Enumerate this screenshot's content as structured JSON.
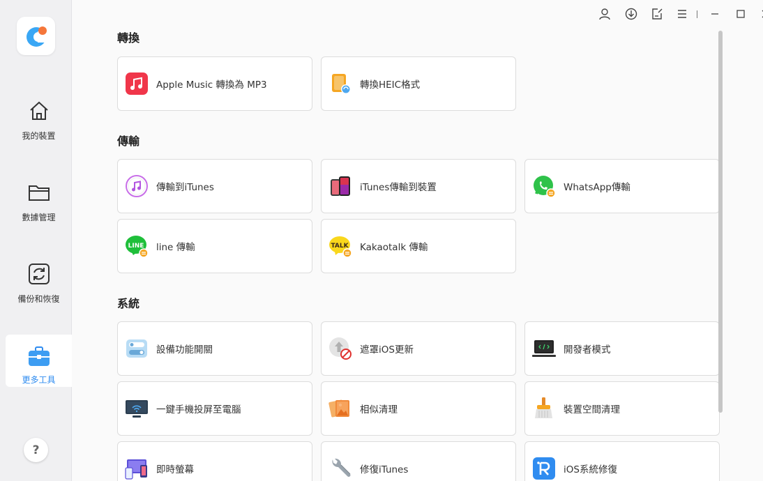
{
  "sidebar": {
    "items": [
      {
        "label": "我的裝置",
        "icon": "home-icon"
      },
      {
        "label": "數據管理",
        "icon": "folder-icon"
      },
      {
        "label": "備份和恢復",
        "icon": "backup-icon"
      },
      {
        "label": "更多工具",
        "icon": "toolbox-icon",
        "active": true
      }
    ],
    "help": "?"
  },
  "topbar": {
    "icons": [
      "user-icon",
      "download-icon",
      "feedback-icon",
      "menu-icon",
      "minimize-icon",
      "maximize-icon",
      "close-icon"
    ]
  },
  "sections": [
    {
      "title": "轉換",
      "cards": [
        {
          "label": "Apple Music 轉換為 MP3",
          "icon": "apple-music-icon"
        },
        {
          "label": "轉換HEIC格式",
          "icon": "heic-convert-icon"
        }
      ]
    },
    {
      "title": "傳輸",
      "cards": [
        {
          "label": "傳輸到iTunes",
          "icon": "itunes-icon"
        },
        {
          "label": "iTunes傳輸到裝置",
          "icon": "phone-icon"
        },
        {
          "label": "WhatsApp傳輸",
          "icon": "whatsapp-icon"
        },
        {
          "label": "line 傳輸",
          "icon": "line-icon"
        },
        {
          "label": "Kakaotalk 傳輸",
          "icon": "kakaotalk-icon"
        }
      ]
    },
    {
      "title": "系統",
      "cards": [
        {
          "label": "設備功能開關",
          "icon": "toggle-icon"
        },
        {
          "label": "遮罩iOS更新",
          "icon": "block-update-icon"
        },
        {
          "label": "開發者模式",
          "icon": "developer-icon"
        },
        {
          "label": "一鍵手機投屏至電腦",
          "icon": "screen-mirror-icon"
        },
        {
          "label": "相似清理",
          "icon": "photo-clean-icon"
        },
        {
          "label": "裝置空間清理",
          "icon": "broom-icon"
        },
        {
          "label": "即時螢幕",
          "icon": "live-screen-icon"
        },
        {
          "label": "修復iTunes",
          "icon": "wrench-icon"
        },
        {
          "label": "iOS系統修復",
          "icon": "ios-repair-icon"
        }
      ]
    }
  ],
  "colors": {
    "accent": "#2f8cf0",
    "sidebar_bg": "#f0f0f2",
    "content_bg": "#fafafa",
    "card_border": "#dcdcdc"
  }
}
